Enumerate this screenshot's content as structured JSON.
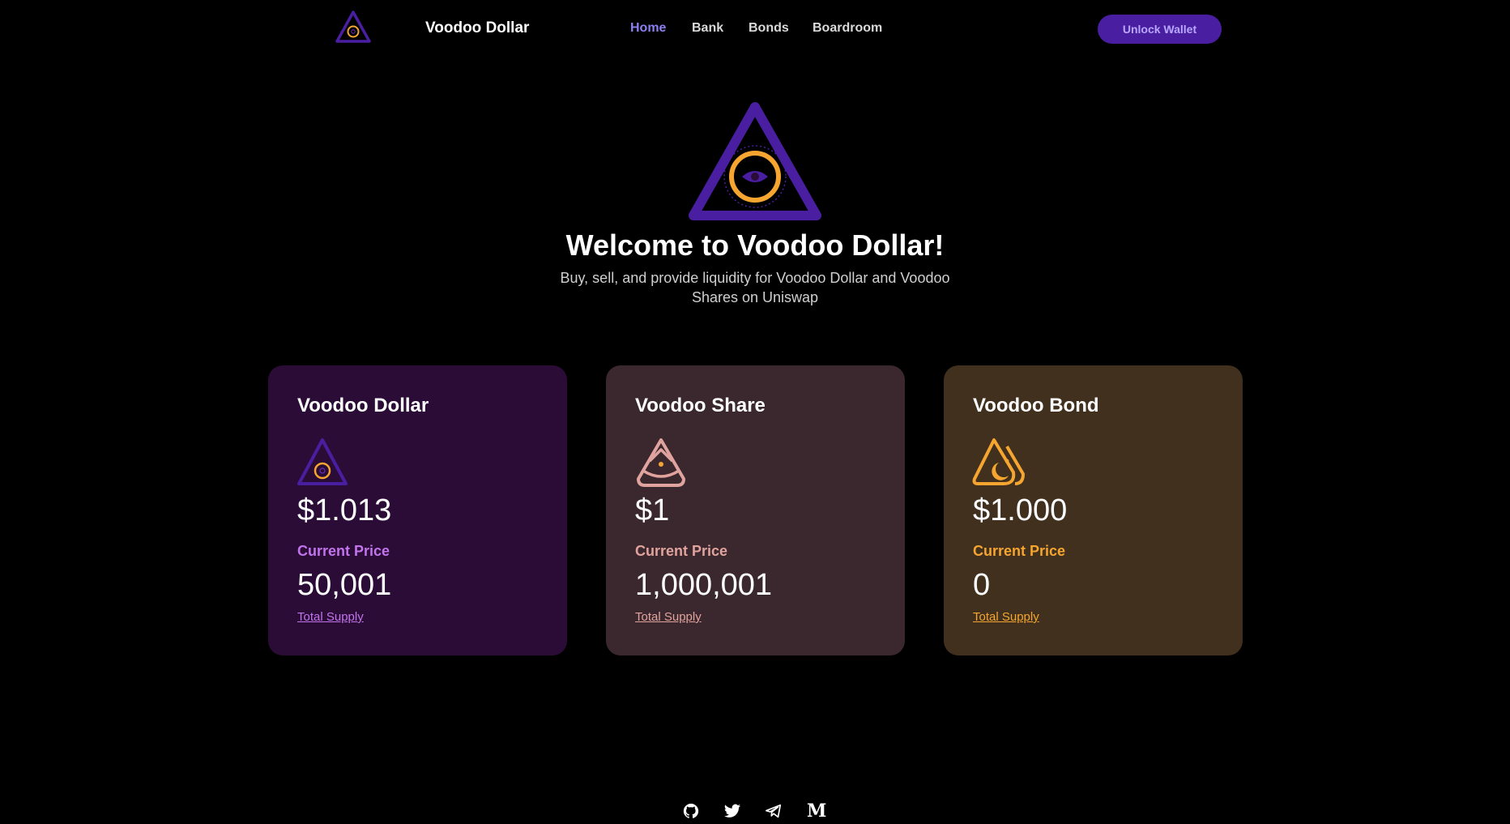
{
  "header": {
    "brand": "Voodoo Dollar",
    "logo_icon": "voodoo-eye-triangle-icon",
    "nav": [
      "Home",
      "Bank",
      "Bonds",
      "Boardroom"
    ],
    "active_nav": "Home",
    "unlock_wallet_label": "Unlock Wallet"
  },
  "hero": {
    "title": "Welcome to Voodoo Dollar!",
    "subtitle": "Buy, sell, and provide liquidity for Voodoo Dollar and Voodoo Shares on Uniswap"
  },
  "cards": [
    {
      "title": "Voodoo Dollar",
      "icon": "voodoo-dollar-icon",
      "price": "$1.013",
      "price_label": "Current Price",
      "supply": "50,001",
      "supply_label": "Total Supply",
      "accent": "#c274ec",
      "background": "#2a0c36"
    },
    {
      "title": "Voodoo Share",
      "icon": "voodoo-share-icon",
      "price": "$1",
      "price_label": "Current Price",
      "supply": "1,000,001",
      "supply_label": "Total Supply",
      "accent": "#e1a39d",
      "background": "#3a282e"
    },
    {
      "title": "Voodoo Bond",
      "icon": "voodoo-bond-icon",
      "price": "$1.000",
      "price_label": "Current Price",
      "supply": "0",
      "supply_label": "Total Supply",
      "accent": "#f5a530",
      "background": "#40301d"
    }
  ],
  "footer": {
    "socials": [
      "github-icon",
      "twitter-icon",
      "telegram-icon",
      "medium-icon"
    ],
    "medium_glyph": "M"
  },
  "colors": {
    "background": "#000000",
    "accent_purple": "#4a1ea0",
    "nav_active": "#8c7ff2"
  }
}
